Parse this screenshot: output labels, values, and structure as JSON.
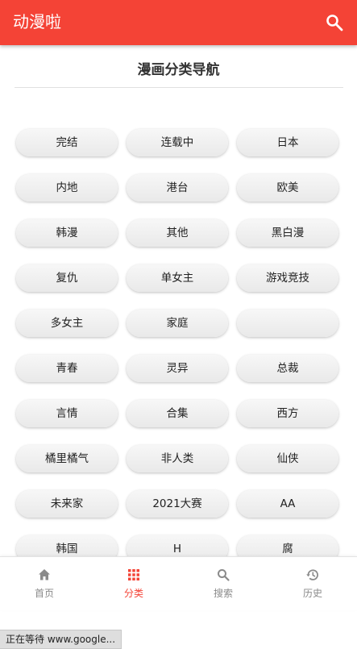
{
  "app": {
    "title": "动漫啦",
    "brand_color": "#f44336"
  },
  "header": {
    "search_icon": "search-icon"
  },
  "section": {
    "title": "漫画分类导航"
  },
  "categories": [
    "完结",
    "连载中",
    "日本",
    "内地",
    "港台",
    "欧美",
    "韩漫",
    "其他",
    "黑白漫",
    "复仇",
    "单女主",
    "游戏竞技",
    "多女主",
    "家庭",
    "",
    "青春",
    "灵异",
    "总裁",
    "言情",
    "合集",
    "西方",
    "橘里橘气",
    "非人类",
    "仙侠",
    "未来家",
    "2021大赛",
    "AA",
    "韩国",
    "H",
    "腐"
  ],
  "nav": {
    "items": [
      {
        "label": "首页",
        "icon": "home-icon"
      },
      {
        "label": "分类",
        "icon": "grid-icon",
        "active": true
      },
      {
        "label": "搜索",
        "icon": "search-icon"
      },
      {
        "label": "历史",
        "icon": "history-icon"
      }
    ]
  },
  "status": {
    "text": "正在等待 www.google..."
  }
}
